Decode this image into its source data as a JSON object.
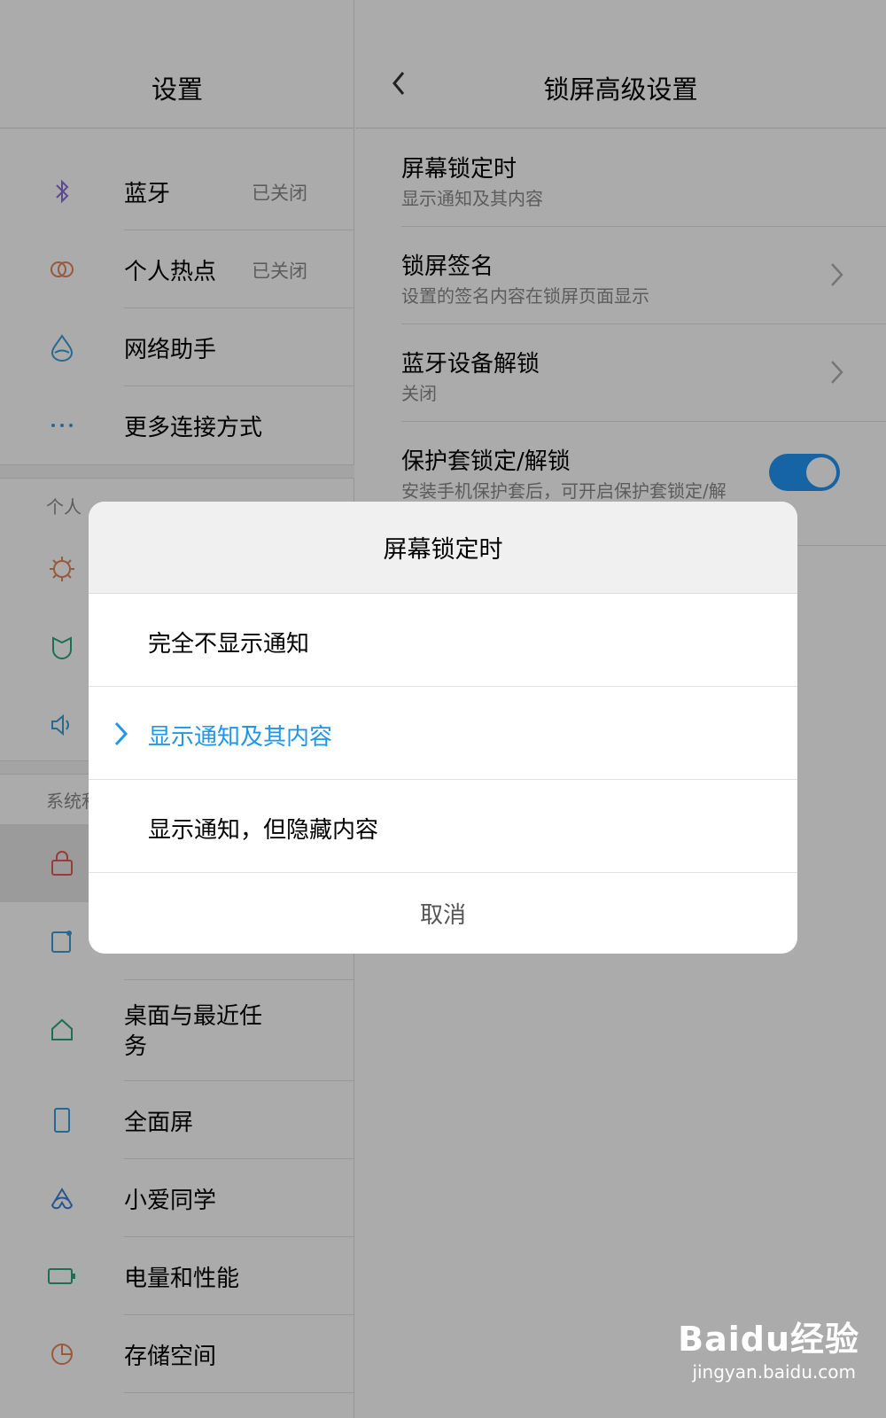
{
  "left_pane": {
    "title": "设置",
    "rows": [
      {
        "label": "蓝牙",
        "value": "已关闭",
        "icon": "bluetooth-icon"
      },
      {
        "label": "个人热点",
        "value": "已关闭",
        "icon": "hotspot-icon"
      },
      {
        "label": "网络助手",
        "value": "",
        "icon": "network-assistant-icon"
      },
      {
        "label": "更多连接方式",
        "value": "",
        "icon": "more-connections-icon"
      }
    ],
    "section_personal": "个人",
    "section_system": "系统和",
    "rows_lower": [
      {
        "label": "桌面与最近任务",
        "icon": "home-icon"
      },
      {
        "label": "全面屏",
        "icon": "phone-icon"
      },
      {
        "label": "小爱同学",
        "icon": "xiaoai-icon"
      },
      {
        "label": "电量和性能",
        "icon": "battery-icon"
      },
      {
        "label": "存储空间",
        "icon": "storage-icon"
      }
    ]
  },
  "right_pane": {
    "title": "锁屏高级设置",
    "rows": [
      {
        "title": "屏幕锁定时",
        "subtitle": "显示通知及其内容"
      },
      {
        "title": "锁屏签名",
        "subtitle": "设置的签名内容在锁屏页面显示"
      },
      {
        "title": "蓝牙设备解锁",
        "subtitle": "关闭"
      },
      {
        "title": "保护套锁定/解锁",
        "subtitle": "安装手机保护套后，可开启保护套锁定/解"
      }
    ],
    "toggle_on": true
  },
  "dialog": {
    "title": "屏幕锁定时",
    "options": [
      {
        "label": "完全不显示通知",
        "selected": false
      },
      {
        "label": "显示通知及其内容",
        "selected": true
      },
      {
        "label": "显示通知，但隐藏内容",
        "selected": false
      }
    ],
    "cancel": "取消"
  },
  "colors": {
    "accent": "#2196e8",
    "toggle": "#2196f3",
    "overlay": "rgba(0,0,0,0.33)"
  },
  "watermark": {
    "main": "Baidu经验",
    "sub": "jingyan.baidu.com"
  }
}
